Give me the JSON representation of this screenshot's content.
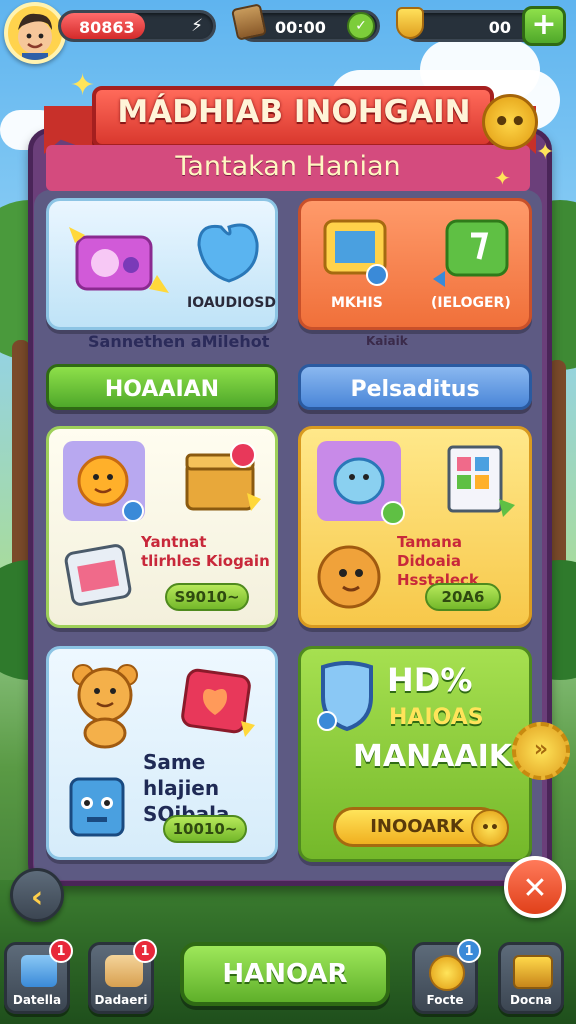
{
  "header": {
    "hearts_value": "80863",
    "hearts_fill_percent": 55,
    "timer_value": "00:00",
    "gold_value": "00",
    "add_label": "+"
  },
  "panel": {
    "title": "MÁDHIAB INOHGAIN",
    "subtitle": "Tantakan Hanian"
  },
  "top_cards": [
    {
      "label": "IOAUDIOSD",
      "caption": "Sannethen aMilehot"
    },
    {
      "label_left": "MKHIS",
      "label_right": "(IELOGER)",
      "caption": "Kaiaik"
    }
  ],
  "tabs": [
    {
      "label": "HOAAIAN"
    },
    {
      "label": "Pelsaditus"
    }
  ],
  "offers": [
    {
      "title": "Yantnat tlirhles Kiogain",
      "price": "S9010~"
    },
    {
      "title": "Tamana Didoaia Hsstaleck",
      "price": "20A6"
    },
    {
      "title": "Same hlajien SOibala",
      "price": "10010~"
    }
  ],
  "feature": {
    "line1": "HD%",
    "line2": "HAIOAS",
    "line3": "MANAAIK",
    "button": "INOOARK"
  },
  "controls": {
    "back_icon": "chevron-left-icon",
    "close_icon": "close-icon",
    "main_button": "HANOAR"
  },
  "nav": [
    {
      "label": "Datella",
      "badge": "1"
    },
    {
      "label": "Dadaeri",
      "badge": "1"
    },
    {
      "label": "Focte",
      "badge": "1"
    },
    {
      "label": "Docna",
      "badge": ""
    }
  ],
  "colors": {
    "accent_green": "#74b82a",
    "accent_red": "#d9382e",
    "panel_purple": "#6b3f7a",
    "tab_blue": "#4a86d8"
  }
}
